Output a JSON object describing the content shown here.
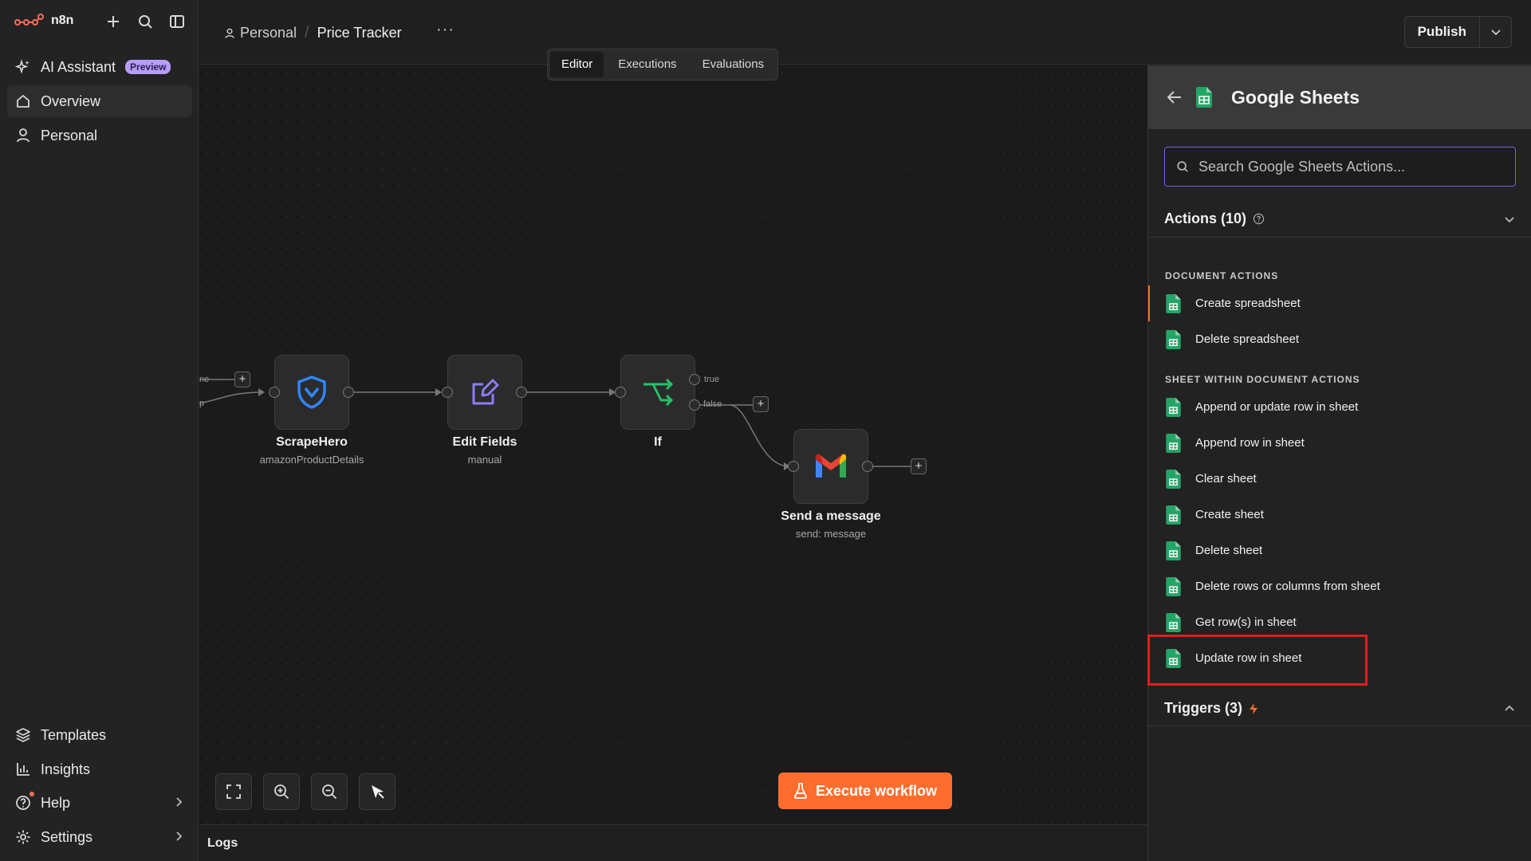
{
  "app": {
    "name": "n8n"
  },
  "sidebar": {
    "ai_assistant": "AI Assistant",
    "preview_badge": "Preview",
    "overview": "Overview",
    "personal": "Personal",
    "templates": "Templates",
    "insights": "Insights",
    "help": "Help",
    "settings": "Settings"
  },
  "header": {
    "breadcrumb_project": "Personal",
    "workflow_title": "Price Tracker",
    "more": "···",
    "tabs": [
      "Editor",
      "Executions",
      "Evaluations"
    ],
    "publish": "Publish"
  },
  "canvas": {
    "nodes": [
      {
        "label": "ScrapeHero",
        "sub": "amazonProductDetails"
      },
      {
        "label": "Edit Fields",
        "sub": "manual"
      },
      {
        "label": "If",
        "sub": ""
      },
      {
        "label": "Send a message",
        "sub": "send: message"
      }
    ],
    "branch_true": "true",
    "branch_false": "false",
    "left_stub_1": "ne",
    "left_stub_2": "p",
    "execute_button": "Execute workflow",
    "logs": "Logs"
  },
  "panel": {
    "title": "Google Sheets",
    "search_placeholder": "Search Google Sheets Actions...",
    "actions_header": "Actions (10)",
    "groups": [
      {
        "title": "DOCUMENT ACTIONS",
        "items": [
          "Create spreadsheet",
          "Delete spreadsheet"
        ]
      },
      {
        "title": "SHEET WITHIN DOCUMENT ACTIONS",
        "items": [
          "Append or update row in sheet",
          "Append row in sheet",
          "Clear sheet",
          "Create sheet",
          "Delete sheet",
          "Delete rows or columns from sheet",
          "Get row(s) in sheet",
          "Update row in sheet"
        ]
      }
    ],
    "triggers_header": "Triggers (3)"
  },
  "colors": {
    "accent": "#ff6d2e",
    "search_border": "#7c5ce8",
    "highlight": "#e01e1e",
    "sheets_green": "#23a566"
  }
}
